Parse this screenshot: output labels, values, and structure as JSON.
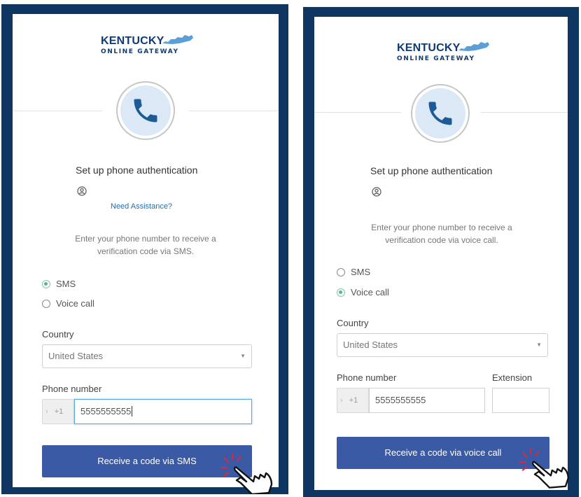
{
  "panels": [
    {
      "logo": {
        "line1": "KENTUCKY",
        "line2": "ONLINE GATEWAY"
      },
      "title": "Set up phone authentication",
      "assist_link": "Need Assistance?",
      "description_line1": "Enter your phone number to receive a",
      "description_line2": "verification code via SMS.",
      "radios": [
        {
          "label": "SMS",
          "checked": true
        },
        {
          "label": "Voice call",
          "checked": false
        }
      ],
      "country_label": "Country",
      "country_value": "United States",
      "phone_label": "Phone number",
      "phone_prefix": "+1",
      "phone_value": "5555555555",
      "button_label": "Receive a code via SMS"
    },
    {
      "logo": {
        "line1": "KENTUCKY",
        "line2": "ONLINE GATEWAY"
      },
      "title": "Set up phone authentication",
      "description_line1": "Enter your phone number to receive a",
      "description_line2": "verification code via voice call.",
      "radios": [
        {
          "label": "SMS",
          "checked": false
        },
        {
          "label": "Voice call",
          "checked": true
        }
      ],
      "country_label": "Country",
      "country_value": "United States",
      "phone_label": "Phone number",
      "extension_label": "Extension",
      "phone_prefix": "+1",
      "phone_value": "5555555555",
      "button_label": "Receive a code via voice call"
    }
  ],
  "colors": {
    "frame": "#0f3661",
    "brand_text": "#0f3a73",
    "state_shape": "#5b9fd6",
    "button": "#3b5aa6",
    "link": "#1f6fb3",
    "radio_on": "#58b58b"
  }
}
